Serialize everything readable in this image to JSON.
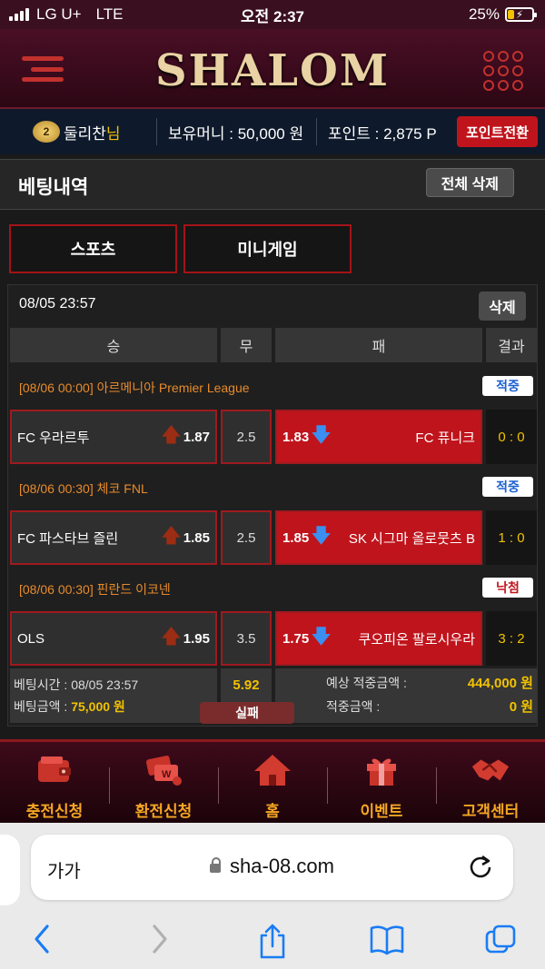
{
  "status_bar": {
    "carrier": "LG U+",
    "network": "LTE",
    "time": "오전 2:37",
    "battery": "25%",
    "battery_level": 0.25
  },
  "header": {
    "logo": "SHALOM"
  },
  "userbar": {
    "level": "2",
    "username": "둘리찬",
    "honorific": "님",
    "money": "보유머니 : 50,000 원",
    "points": "포인트 : 2,875 P",
    "convert_button": "포인트전환"
  },
  "page": {
    "title": "베팅내역",
    "delete_all": "전체 삭제"
  },
  "tabs": [
    {
      "label": "스포츠"
    },
    {
      "label": "미니게임"
    }
  ],
  "bet": {
    "datetime": "08/05 23:57",
    "delete_label": "삭제",
    "columns": {
      "win": "승",
      "draw": "무",
      "lose": "패",
      "result": "결과"
    },
    "games": [
      {
        "league": "[08/06 00:00] 아르메니아 Premier League",
        "status": "적중",
        "home": "FC 우라르투",
        "home_odds": "1.87",
        "draw": "2.5",
        "away_odds": "1.83",
        "away": "FC 퓨니크",
        "score": "0 : 0"
      },
      {
        "league": "[08/06 00:30] 체코 FNL",
        "status": "적중",
        "home": "FC 파스타브 즐린",
        "home_odds": "1.85",
        "draw": "2.5",
        "away_odds": "1.85",
        "away": "SK 시그마 올로뭇츠 B",
        "score": "1 : 0"
      },
      {
        "league": "[08/06 00:30] 핀란드 이코넨",
        "status": "낙첨",
        "home": "OLS",
        "home_odds": "1.95",
        "draw": "3.5",
        "away_odds": "1.75",
        "away": "쿠오피온 팔로시우라",
        "score": "3 : 2"
      }
    ],
    "summary": {
      "bet_time_label": "베팅시간 : ",
      "bet_time": "08/05 23:57",
      "bet_amount_label": "베팅금액 : ",
      "bet_amount": "75,000 원",
      "total_odds": "5.92",
      "expected_label": "예상 적중금액 :",
      "expected": "444,000 원",
      "win_label": "적중금액 :",
      "win": "0 원",
      "status": "실패"
    }
  },
  "bottom_nav": [
    {
      "label": "충전신청",
      "icon": "wallet-icon"
    },
    {
      "label": "환전신청",
      "icon": "exchange-icon"
    },
    {
      "label": "홈",
      "icon": "home-icon"
    },
    {
      "label": "이벤트",
      "icon": "gift-icon"
    },
    {
      "label": "고객센터",
      "icon": "handshake-icon"
    }
  ],
  "browser": {
    "text_size": "가가",
    "url": "sha-08.com"
  }
}
